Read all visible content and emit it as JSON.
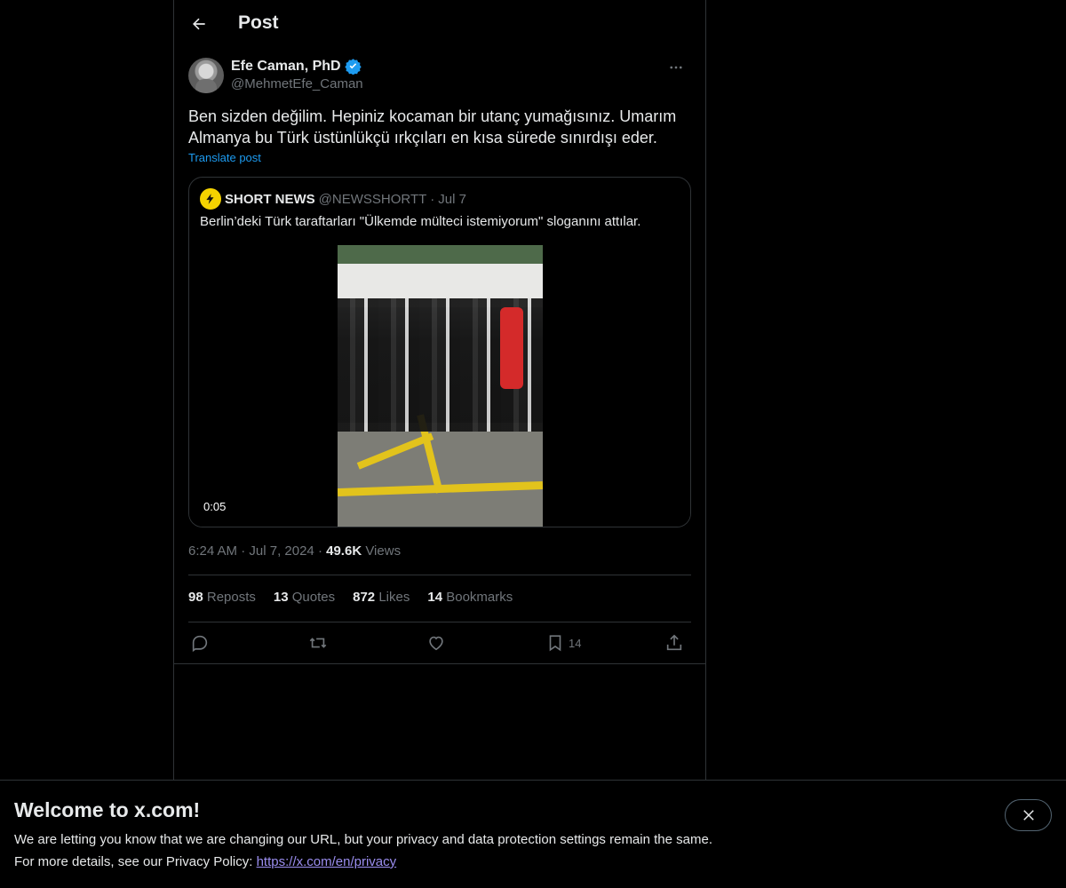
{
  "header": {
    "title": "Post"
  },
  "post": {
    "author": {
      "display_name": "Efe Caman, PhD",
      "handle": "@MehmetEfe_Caman",
      "verified": true
    },
    "text_line1": "Ben sizden değilim. Hepiniz kocaman bir utanç yumağısınız. Umarım",
    "text_line2": "Almanya bu Türk üstünlükçü ırkçıları en kısa sürede sınırdışı eder.",
    "translate_label": "Translate post",
    "quote": {
      "name": "SHORT NEWS",
      "handle": "@NEWSSHORTT",
      "separator": "·",
      "date": "Jul 7",
      "text": "Berlin’deki Türk taraftarları \"Ülkemde mülteci istemiyorum\" sloganını attılar.",
      "video_duration": "0:05"
    },
    "meta": {
      "time": "6:24 AM",
      "separator": "·",
      "date": "Jul 7, 2024",
      "views_count": "49.6K",
      "views_label": "Views"
    },
    "stats": {
      "reposts_count": "98",
      "reposts_label": "Reposts",
      "quotes_count": "13",
      "quotes_label": "Quotes",
      "likes_count": "872",
      "likes_label": "Likes",
      "bookmarks_count": "14",
      "bookmarks_label": "Bookmarks"
    },
    "actions": {
      "bookmark_count": "14"
    }
  },
  "banner": {
    "title": "Welcome to x.com!",
    "line1": "We are letting you know that we are changing our URL, but your privacy and data protection settings remain the same.",
    "line2_prefix": "For more details, see our Privacy Policy: ",
    "link": "https://x.com/en/privacy"
  },
  "icons": {
    "back": "arrow-left-icon",
    "verified": "verified-badge-icon",
    "more": "more-horizontal-icon",
    "reply": "reply-icon",
    "repost": "repost-icon",
    "like": "heart-icon",
    "bookmark": "bookmark-icon",
    "share": "share-icon",
    "close": "close-icon"
  },
  "colors": {
    "background": "#000000",
    "text": "#e7e9ea",
    "secondary_text": "#71767b",
    "accent": "#1d9bf0",
    "border": "#2f3336"
  }
}
